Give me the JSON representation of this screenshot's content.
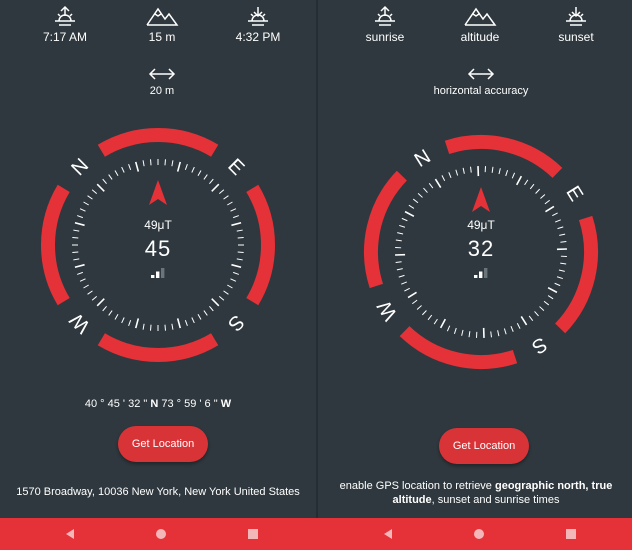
{
  "colors": {
    "background": "#2f383e",
    "accent": "#e43238",
    "button": "#d83438",
    "text": "#ffffff"
  },
  "left": {
    "sunrise": {
      "icon": "sunrise-icon",
      "value": "7:17 AM"
    },
    "altitude": {
      "icon": "mountain-icon",
      "value": "15 m"
    },
    "sunset": {
      "icon": "sunset-icon",
      "value": "4:32 PM"
    },
    "accuracy": {
      "icon": "horizontal-arrows-icon",
      "value": "20 m"
    },
    "compass": {
      "field": "49μT",
      "heading": "45",
      "cardinal": {
        "n": "N",
        "e": "E",
        "s": "S",
        "w": "W"
      },
      "signal_level": 2,
      "signal_max": 3
    },
    "coords": {
      "lat": "40 ° 45 ' 32 \"",
      "lat_dir": "N",
      "lon": "73 ° 59 ' 6 \"",
      "lon_dir": "W"
    },
    "button": "Get Location",
    "address": "1570 Broadway, 10036 New York, New York United States"
  },
  "right": {
    "sunrise": {
      "icon": "sunrise-icon",
      "value": "sunrise"
    },
    "altitude": {
      "icon": "mountain-icon",
      "value": "altitude"
    },
    "sunset": {
      "icon": "sunset-icon",
      "value": "sunset"
    },
    "accuracy": {
      "icon": "horizontal-arrows-icon",
      "value": "horizontal accuracy"
    },
    "compass": {
      "field": "49μT",
      "heading": "32",
      "cardinal": {
        "n": "N",
        "e": "E",
        "s": "S",
        "w": "W"
      },
      "signal_level": 2,
      "signal_max": 3
    },
    "button": "Get Location",
    "hint": {
      "prefix": "enable GPS location to retrieve ",
      "bold1": "geographic north, true altitude",
      "middle": ", sunset and sunrise times"
    }
  },
  "navbar": {
    "back": "back-icon",
    "home": "home-icon",
    "recents": "recents-icon"
  }
}
